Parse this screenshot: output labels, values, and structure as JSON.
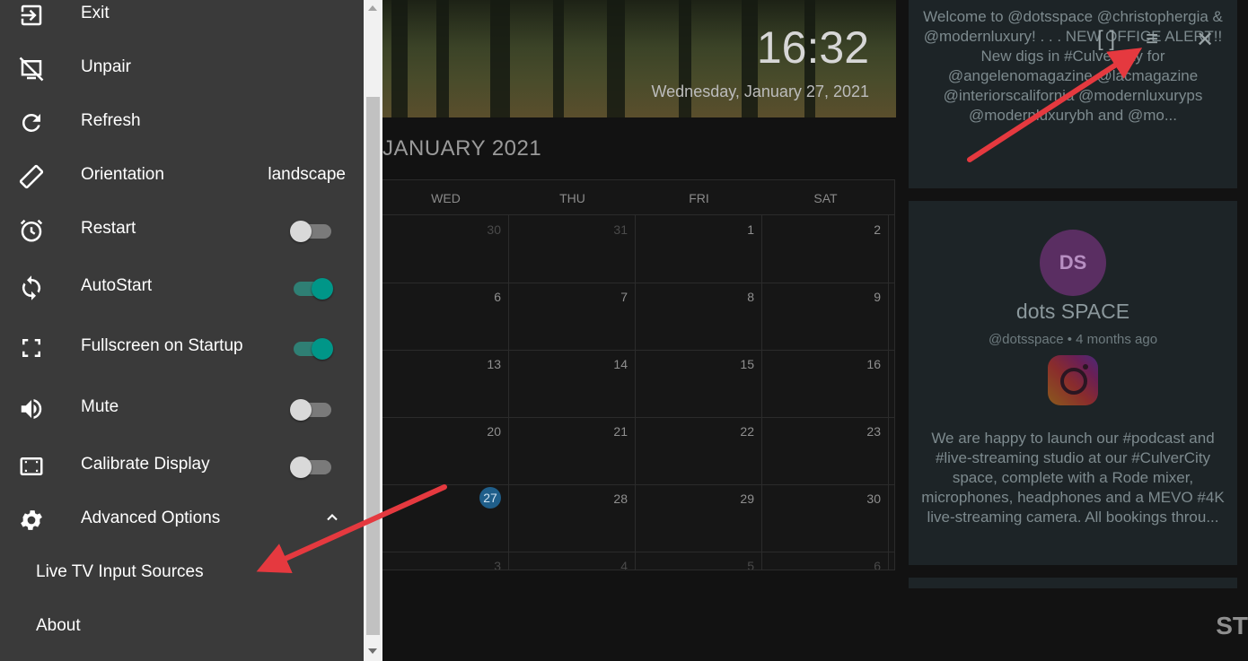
{
  "drawer": {
    "items": [
      {
        "label": "Exit",
        "icon": "exit-icon"
      },
      {
        "label": "Unpair",
        "icon": "unpair-icon"
      },
      {
        "label": "Refresh",
        "icon": "refresh-icon"
      },
      {
        "label": "Orientation",
        "icon": "orientation-icon",
        "value": "landscape"
      },
      {
        "label": "Restart",
        "icon": "alarm-clock-icon",
        "toggle": false
      },
      {
        "label": "AutoStart",
        "icon": "sync-icon",
        "toggle": true
      },
      {
        "label": "Fullscreen on Startup",
        "icon": "fullscreen-icon",
        "toggle": true
      },
      {
        "label": "Mute",
        "icon": "speaker-icon",
        "toggle": false
      },
      {
        "label": "Calibrate Display",
        "icon": "calibrate-icon",
        "toggle": false
      },
      {
        "label": "Advanced Options",
        "icon": "gear-icon",
        "expanded": true
      }
    ],
    "subitems": [
      {
        "label": "Live TV Input Sources"
      },
      {
        "label": "About"
      }
    ]
  },
  "hero": {
    "time": "16:32",
    "date": "Wednesday, January 27, 2021"
  },
  "calendar": {
    "month_label": "JANUARY 2021",
    "weekdays": [
      "WED",
      "THU",
      "FRI",
      "SAT"
    ],
    "weeks": [
      [
        "30",
        "31",
        "1",
        "2"
      ],
      [
        "6",
        "7",
        "8",
        "9"
      ],
      [
        "13",
        "14",
        "15",
        "16"
      ],
      [
        "20",
        "21",
        "22",
        "23"
      ],
      [
        "27",
        "28",
        "29",
        "30"
      ],
      [
        "3",
        "4",
        "5",
        "6"
      ]
    ],
    "today": "27"
  },
  "social": {
    "post1_text": "Welcome to @dotsspace @christophergia & @modernluxury! . . . NEW OFFICE ALERT!! New digs in #CulverCity for @angelenomagazine @lacmagazine @interiorscalifornia @modernluxuryps @modernluxurybh and @mo...",
    "avatar_initials": "DS",
    "account_name": "dots SPACE",
    "account_meta": "@dotsspace • 4 months ago",
    "post2_text": "We are happy to launch our #podcast and #live-streaming studio at our #CulverCity space, complete with a Rode mixer, microphones, headphones and a MEVO #4K live-streaming camera. All bookings throu..."
  },
  "footer_text": "ST",
  "colors": {
    "drawer_bg": "#3a3a3a",
    "toggle_on": "#009688",
    "arrow": "#e5393f",
    "today": "#1f5e8a"
  }
}
